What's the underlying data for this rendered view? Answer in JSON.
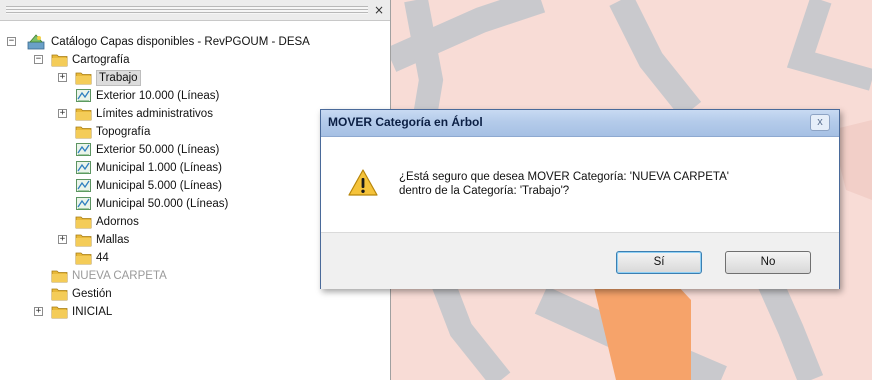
{
  "tree": {
    "root": {
      "label": "Catálogo Capas disponibles - RevPGOUM - DESA",
      "expanded": true
    },
    "items": [
      {
        "label": "Cartografía",
        "level": 1,
        "icon": "folder-icon",
        "toggle": "-",
        "state": "normal"
      },
      {
        "label": "Trabajo",
        "level": 2,
        "icon": "folder-icon",
        "toggle": "+",
        "state": "selected"
      },
      {
        "label": "Exterior 10.000 (Líneas)",
        "level": 2,
        "icon": "layer-icon",
        "toggle": "",
        "state": "normal"
      },
      {
        "label": "Límites administrativos",
        "level": 2,
        "icon": "folder-icon",
        "toggle": "+",
        "state": "normal"
      },
      {
        "label": "Topografía",
        "level": 2,
        "icon": "folder-icon",
        "toggle": "",
        "state": "normal"
      },
      {
        "label": "Exterior 50.000 (Líneas)",
        "level": 2,
        "icon": "layer-icon",
        "toggle": "",
        "state": "normal"
      },
      {
        "label": "Municipal 1.000 (Líneas)",
        "level": 2,
        "icon": "layer-icon",
        "toggle": "",
        "state": "normal"
      },
      {
        "label": "Municipal 5.000 (Líneas)",
        "level": 2,
        "icon": "layer-icon",
        "toggle": "",
        "state": "normal"
      },
      {
        "label": "Municipal 50.000 (Líneas)",
        "level": 2,
        "icon": "layer-icon",
        "toggle": "",
        "state": "normal"
      },
      {
        "label": "Adornos",
        "level": 2,
        "icon": "folder-icon",
        "toggle": "",
        "state": "normal"
      },
      {
        "label": "Mallas",
        "level": 2,
        "icon": "folder-icon",
        "toggle": "+",
        "state": "normal"
      },
      {
        "label": "44",
        "level": 2,
        "icon": "folder-icon",
        "toggle": "",
        "state": "normal"
      },
      {
        "label": "NUEVA CARPETA",
        "level": 1,
        "icon": "folder-icon",
        "toggle": "",
        "state": "disabled"
      },
      {
        "label": "Gestión",
        "level": 1,
        "icon": "folder-icon",
        "toggle": "",
        "state": "normal"
      },
      {
        "label": "INICIAL",
        "level": 1,
        "icon": "folder-icon",
        "toggle": "+",
        "state": "normal"
      }
    ]
  },
  "panel": {
    "close_glyph": "×"
  },
  "dialog": {
    "title": "MOVER Categoría en Árbol",
    "close_glyph": "x",
    "message_line1": "¿Está seguro que desea MOVER  Categoría: 'NUEVA CARPETA'",
    "message_line2": "dentro de la Categoría: 'Trabajo'?",
    "yes_label": "Sí",
    "no_label": "No",
    "icon": "warning-icon"
  },
  "colors": {
    "map_background": "#f8dcd6",
    "map_road": "#c8c8cc",
    "map_highlight": "#f6a36a",
    "folder": "#e8b93a",
    "dialog_title_gradient": "#b4cbea"
  }
}
